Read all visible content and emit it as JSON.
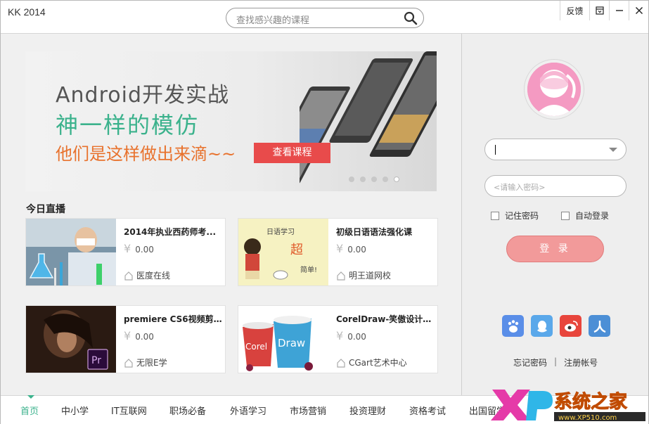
{
  "app": {
    "title": "KK 2014"
  },
  "search": {
    "placeholder": "查找感兴趣的课程"
  },
  "toolbar": {
    "feedback": "反馈"
  },
  "banner": {
    "line1": "Android开发实战",
    "line2": "神一样的模仿",
    "line3": "他们是这样做出来滴~~",
    "cta": "查看课程",
    "slides": 5,
    "active_slide": 5
  },
  "live": {
    "heading": "今日直播",
    "cards": [
      {
        "title": "2014年执业西药师考...",
        "currency": "¥",
        "price": "0.00",
        "org": "医度在线"
      },
      {
        "title": "初级日语语法强化课",
        "currency": "¥",
        "price": "0.00",
        "org": "明王道网校"
      },
      {
        "title": "premiere CS6视频剪辑...",
        "currency": "¥",
        "price": "0.00",
        "org": "无限E学"
      },
      {
        "title": "CorelDraw-笑傲设计职场",
        "currency": "¥",
        "price": "0.00",
        "org": "CGart艺术中心"
      }
    ]
  },
  "login": {
    "password_placeholder": "<请输入密码>",
    "remember": "记住密码",
    "auto_login": "自动登录",
    "button": "登 录",
    "forgot": "忘记密码",
    "separator": "|",
    "register": "注册帐号"
  },
  "thumbs": {
    "japanese_text": "日语学习",
    "japanese_big": "超",
    "japanese_extra": "简单!",
    "premiere_badge": "Pr",
    "corel_a": "Corel",
    "corel_b": "Draw"
  },
  "nav": {
    "items": [
      "首页",
      "中小学",
      "IT互联网",
      "职场必备",
      "外语学习",
      "市场营销",
      "投资理财",
      "资格考试",
      "出国留学"
    ],
    "active": 0
  },
  "watermark": {
    "logo": "XP",
    "name": "系统之家",
    "url": "www.XP510.com"
  },
  "colors": {
    "accent": "#3bb28c",
    "orange": "#e8722d",
    "cta": "#e84b4b",
    "login": "#f29a9a"
  }
}
